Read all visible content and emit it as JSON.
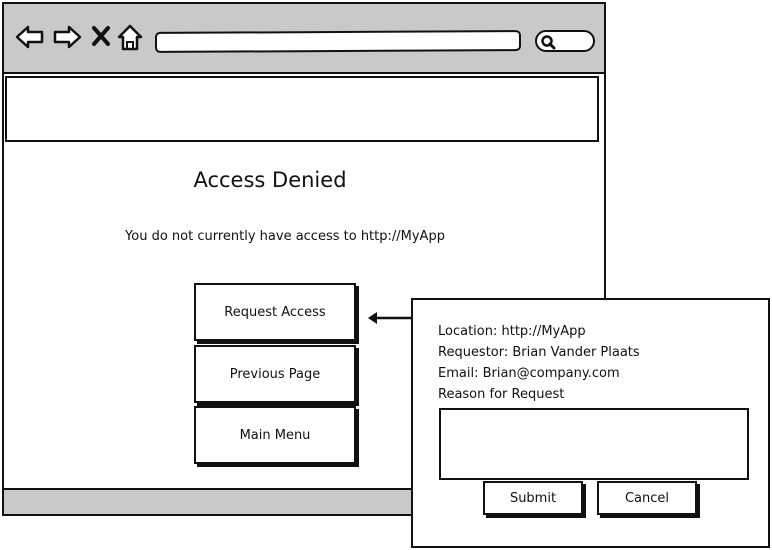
{
  "browser": {
    "nav_icons": [
      "back-arrow-icon",
      "forward-arrow-icon",
      "close-x-icon",
      "home-icon"
    ],
    "search_icon": "search-icon"
  },
  "page": {
    "title": "Access Denied",
    "message": "You do not currently have access to http://MyApp",
    "buttons": {
      "request_access": "Request Access",
      "previous_page": "Previous Page",
      "main_menu": "Main Menu"
    }
  },
  "dialog": {
    "location": "Location: http://MyApp",
    "requestor": "Requestor: Brian Vander Plaats",
    "email": "Email: Brian@company.com",
    "reason_label": "Reason for Request",
    "reason_value": "",
    "submit": "Submit",
    "cancel": "Cancel"
  }
}
